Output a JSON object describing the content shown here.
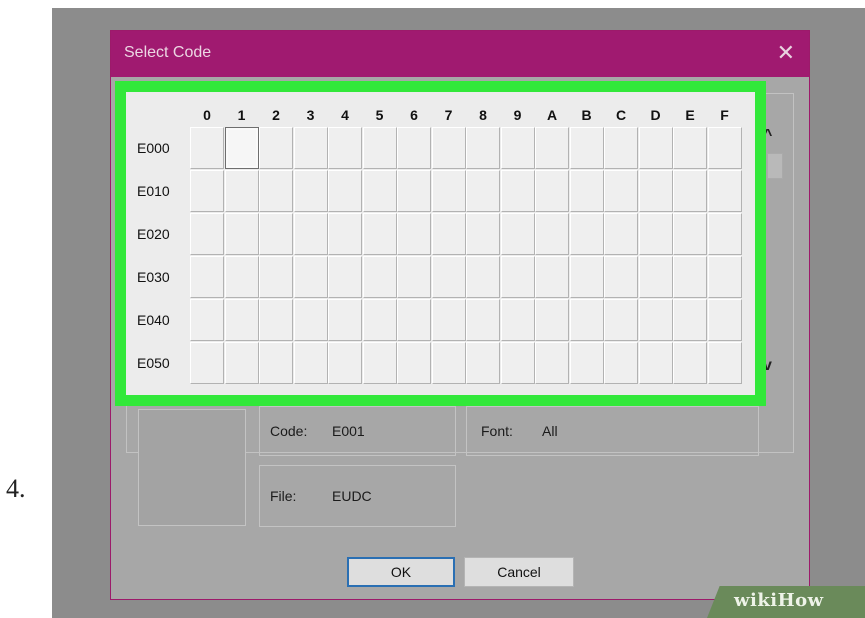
{
  "step_number": "4.",
  "dialog": {
    "title": "Select Code",
    "close_symbol": "✕"
  },
  "grid": {
    "columns": [
      "0",
      "1",
      "2",
      "3",
      "4",
      "5",
      "6",
      "7",
      "8",
      "9",
      "A",
      "B",
      "C",
      "D",
      "E",
      "F"
    ],
    "rows": [
      "E000",
      "E010",
      "E020",
      "E030",
      "E040",
      "E050"
    ],
    "selected": {
      "row": "E000",
      "column": "1"
    }
  },
  "scroll": {
    "up_symbol": "^",
    "down_symbol": "v"
  },
  "info": {
    "code_label": "Code:",
    "code_value": "E001",
    "font_label": "Font:",
    "font_value": "All",
    "file_label": "File:",
    "file_value": "EUDC"
  },
  "buttons": {
    "ok": "OK",
    "cancel": "Cancel"
  },
  "watermark": "wikiHow",
  "colors": {
    "titlebar": "#a01a70",
    "highlight": "#32e83a",
    "ok_border": "#2a6fb3"
  }
}
